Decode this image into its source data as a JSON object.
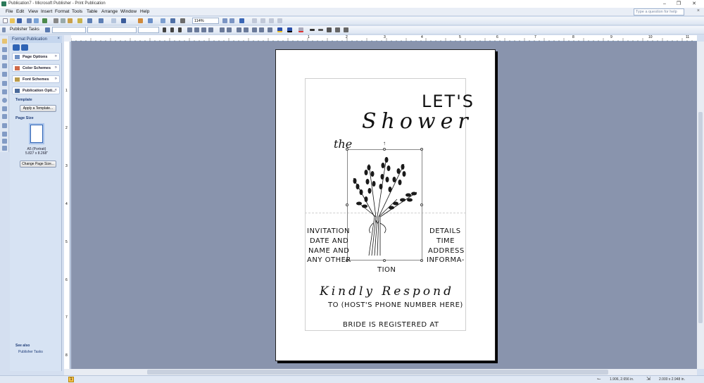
{
  "window": {
    "title": "Publication7 - Microsoft Publisher - Print Publication",
    "controls": [
      "–",
      "❐",
      "✕"
    ]
  },
  "menubar": {
    "items": [
      "File",
      "Edit",
      "View",
      "Insert",
      "Format",
      "Tools",
      "Table",
      "Arrange",
      "Window",
      "Help"
    ],
    "ask_placeholder": "Type a question for help"
  },
  "toolbar": {
    "zoom": "114%",
    "publisher_tasks": "Publisher Tasks"
  },
  "taskpane": {
    "title": "Format Publication",
    "sections": [
      "Page Options",
      "Color Schemes",
      "Font Schemes",
      "Publication Opti..."
    ],
    "template_label": "Template",
    "apply_template": "Apply a Template...",
    "page_size_label": "Page Size",
    "page_size_name": "A5 (Portrait)",
    "page_size_dims": "5.827 x 8.268\"",
    "change_page_size": "Change Page Size...",
    "see_also": "See also",
    "see_also_link": "Publisher Tasks"
  },
  "ruler": {
    "top_labels": [
      "1",
      "2",
      "3",
      "4",
      "5",
      "6",
      "7",
      "8",
      "9",
      "10",
      "11"
    ],
    "left_labels": [
      "1",
      "2",
      "3",
      "4",
      "5",
      "6",
      "7",
      "8"
    ]
  },
  "document": {
    "lets": "LET'S",
    "shower": "Shower",
    "the": "the",
    "left_block": [
      "INVITATION",
      "DATE AND",
      "NAME AND",
      "ANY OTHER"
    ],
    "right_block": [
      "DETAILS",
      "TIME",
      "ADDRESS",
      "INFORMA-"
    ],
    "tion": "TION",
    "kindly_respond": "Kindly Respond",
    "host_phone": "TO (HOST'S PHONE NUMBER HERE)",
    "registered": "BRIDE IS REGISTERED AT"
  },
  "status": {
    "page": "1",
    "position": "1.906, 2.656 in.",
    "size": "2.000 x 2.948 in."
  }
}
